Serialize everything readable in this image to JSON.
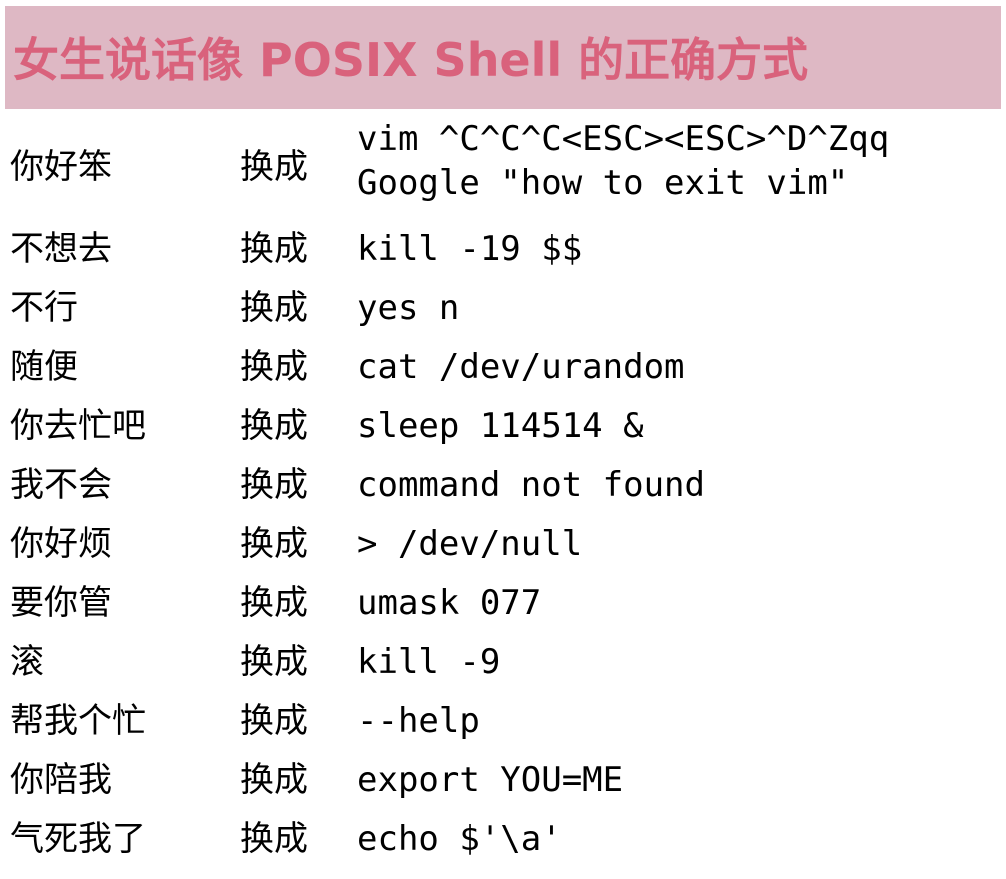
{
  "title": "女生说话像 POSIX Shell 的正确方式",
  "arrow_label": "换成",
  "colors": {
    "title_bg": "#deb8c4",
    "title_text": "#d9627c"
  },
  "rows": [
    {
      "phrase": "你好笨",
      "command_lines": [
        "vim ^C^C^C<ESC><ESC>^D^Zqq",
        "Google \"how to exit vim\""
      ]
    },
    {
      "phrase": "不想去",
      "command_lines": [
        "kill -19 $$"
      ]
    },
    {
      "phrase": "不行",
      "command_lines": [
        "yes n"
      ]
    },
    {
      "phrase": "随便",
      "command_lines": [
        "cat /dev/urandom"
      ]
    },
    {
      "phrase": "你去忙吧",
      "command_lines": [
        "sleep 114514 &"
      ]
    },
    {
      "phrase": "我不会",
      "command_lines": [
        "command not found"
      ]
    },
    {
      "phrase": "你好烦",
      "command_lines": [
        "> /dev/null"
      ]
    },
    {
      "phrase": "要你管",
      "command_lines": [
        "umask 077"
      ]
    },
    {
      "phrase": "滚",
      "command_lines": [
        "kill -9"
      ]
    },
    {
      "phrase": "帮我个忙",
      "command_lines": [
        "--help"
      ]
    },
    {
      "phrase": "你陪我",
      "command_lines": [
        "export YOU=ME"
      ]
    },
    {
      "phrase": "气死我了",
      "command_lines": [
        "echo $'\\a'"
      ]
    }
  ]
}
